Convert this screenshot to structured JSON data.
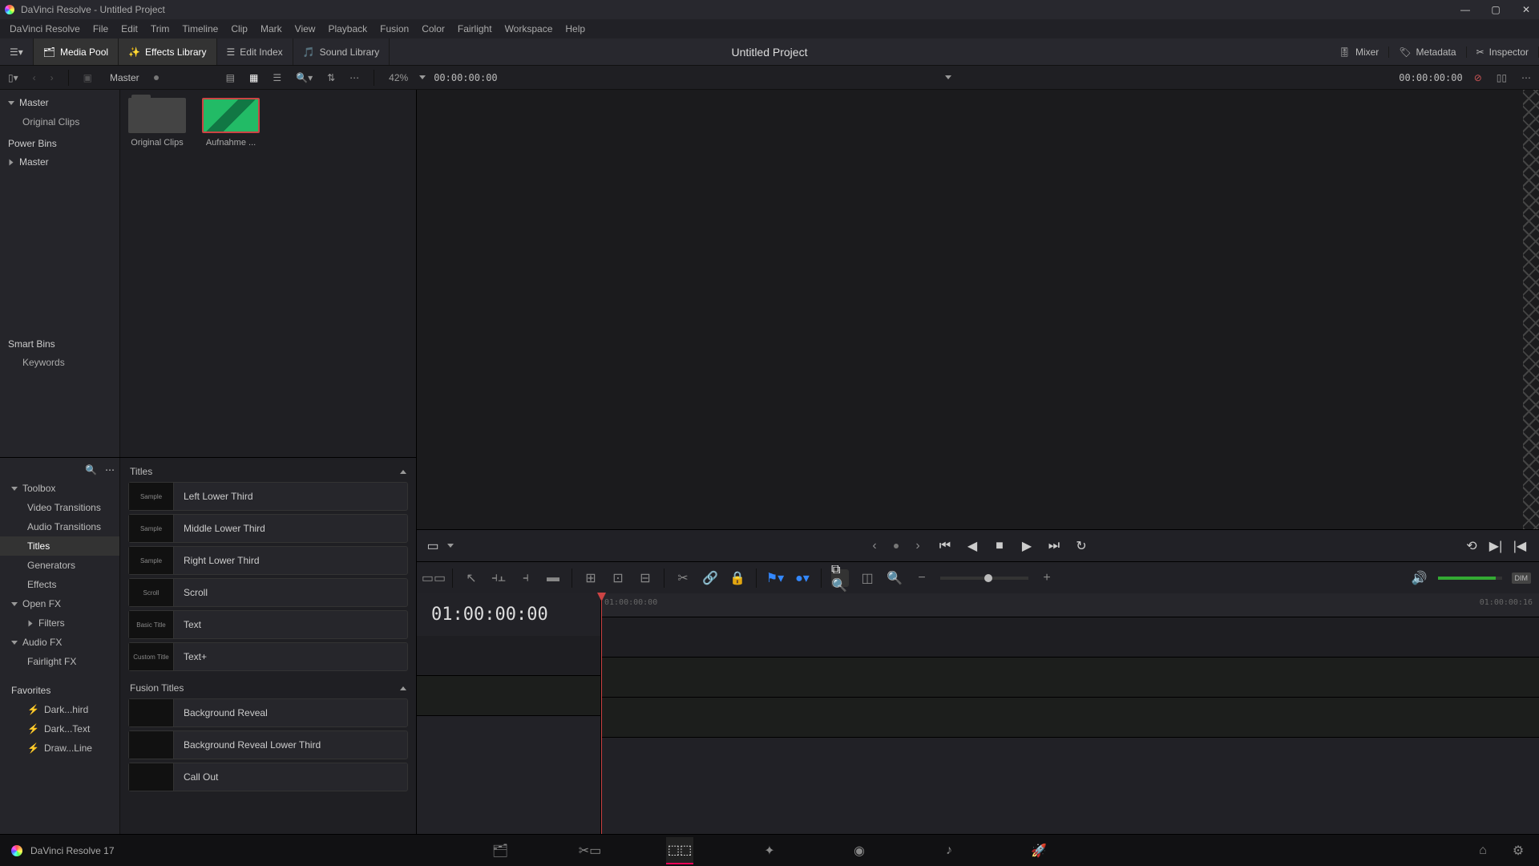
{
  "window": {
    "title": "DaVinci Resolve - Untitled Project"
  },
  "menu": [
    "DaVinci Resolve",
    "File",
    "Edit",
    "Trim",
    "Timeline",
    "Clip",
    "Mark",
    "View",
    "Playback",
    "Fusion",
    "Color",
    "Fairlight",
    "Workspace",
    "Help"
  ],
  "toolbar": {
    "media_pool": "Media Pool",
    "effects_library": "Effects Library",
    "edit_index": "Edit Index",
    "sound_library": "Sound Library",
    "mixer": "Mixer",
    "metadata": "Metadata",
    "inspector": "Inspector",
    "project_title": "Untitled Project"
  },
  "subbar": {
    "master": "Master",
    "zoom_pct": "42%",
    "viewer_tc": "00:00:00:00",
    "right_tc": "00:00:00:00"
  },
  "bins": {
    "master": "Master",
    "original_clips": "Original Clips",
    "power_bins": "Power Bins",
    "smart_bins": "Smart Bins",
    "keywords": "Keywords"
  },
  "clips": [
    {
      "name": "Original Clips",
      "type": "folder"
    },
    {
      "name": "Aufnahme ...",
      "type": "video"
    }
  ],
  "fx": {
    "toolbox": "Toolbox",
    "video_transitions": "Video Transitions",
    "audio_transitions": "Audio Transitions",
    "titles_nav": "Titles",
    "generators": "Generators",
    "effects": "Effects",
    "open_fx": "Open FX",
    "filters": "Filters",
    "audio_fx": "Audio FX",
    "fairlight_fx": "Fairlight FX",
    "favorites": "Favorites",
    "favorites_items": [
      "Dark...hird",
      "Dark...Text",
      "Draw...Line"
    ],
    "titles_section": "Titles",
    "fusion_titles_section": "Fusion Titles",
    "titles": [
      {
        "label": "Left Lower Third",
        "thumb": "Sample"
      },
      {
        "label": "Middle Lower Third",
        "thumb": "Sample"
      },
      {
        "label": "Right Lower Third",
        "thumb": "Sample"
      },
      {
        "label": "Scroll",
        "thumb": "Scroll"
      },
      {
        "label": "Text",
        "thumb": "Basic Title"
      },
      {
        "label": "Text+",
        "thumb": "Custom Title"
      }
    ],
    "fusion_titles": [
      {
        "label": "Background Reveal",
        "thumb": ""
      },
      {
        "label": "Background Reveal Lower Third",
        "thumb": ""
      },
      {
        "label": "Call Out",
        "thumb": ""
      }
    ]
  },
  "timeline": {
    "tc": "01:00:00:00",
    "ruler_start": "01:00:00:00",
    "ruler_end": "01:00:00:16",
    "dim_label": "DIM"
  },
  "footer": {
    "version": "DaVinci Resolve 17"
  }
}
